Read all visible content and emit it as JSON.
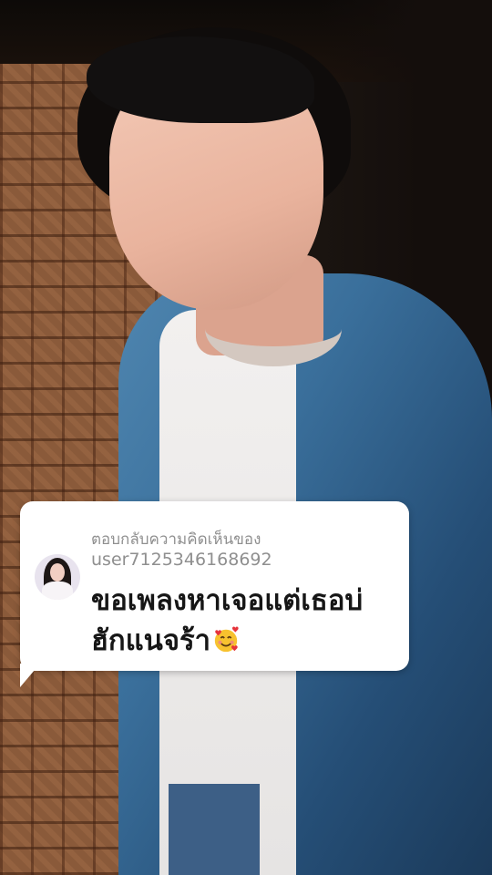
{
  "reply_bubble": {
    "header": "ตอบกลับความคิดเห็นของ",
    "username": "user7125346168692",
    "comment_line1": "ขอเพลงหาเจอแต่เธอบ่",
    "comment_line2": "ฮักแนจร้า",
    "emoji_icon": "smiling-face-with-hearts-icon"
  }
}
